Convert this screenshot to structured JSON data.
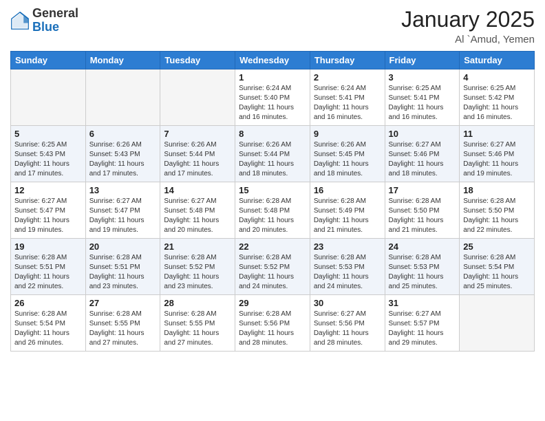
{
  "header": {
    "logo_general": "General",
    "logo_blue": "Blue",
    "month_year": "January 2025",
    "location": "Al `Amud, Yemen"
  },
  "days_of_week": [
    "Sunday",
    "Monday",
    "Tuesday",
    "Wednesday",
    "Thursday",
    "Friday",
    "Saturday"
  ],
  "weeks": [
    [
      {
        "day": "",
        "info": ""
      },
      {
        "day": "",
        "info": ""
      },
      {
        "day": "",
        "info": ""
      },
      {
        "day": "1",
        "info": "Sunrise: 6:24 AM\nSunset: 5:40 PM\nDaylight: 11 hours and 16 minutes."
      },
      {
        "day": "2",
        "info": "Sunrise: 6:24 AM\nSunset: 5:41 PM\nDaylight: 11 hours and 16 minutes."
      },
      {
        "day": "3",
        "info": "Sunrise: 6:25 AM\nSunset: 5:41 PM\nDaylight: 11 hours and 16 minutes."
      },
      {
        "day": "4",
        "info": "Sunrise: 6:25 AM\nSunset: 5:42 PM\nDaylight: 11 hours and 16 minutes."
      }
    ],
    [
      {
        "day": "5",
        "info": "Sunrise: 6:25 AM\nSunset: 5:43 PM\nDaylight: 11 hours and 17 minutes."
      },
      {
        "day": "6",
        "info": "Sunrise: 6:26 AM\nSunset: 5:43 PM\nDaylight: 11 hours and 17 minutes."
      },
      {
        "day": "7",
        "info": "Sunrise: 6:26 AM\nSunset: 5:44 PM\nDaylight: 11 hours and 17 minutes."
      },
      {
        "day": "8",
        "info": "Sunrise: 6:26 AM\nSunset: 5:44 PM\nDaylight: 11 hours and 18 minutes."
      },
      {
        "day": "9",
        "info": "Sunrise: 6:26 AM\nSunset: 5:45 PM\nDaylight: 11 hours and 18 minutes."
      },
      {
        "day": "10",
        "info": "Sunrise: 6:27 AM\nSunset: 5:46 PM\nDaylight: 11 hours and 18 minutes."
      },
      {
        "day": "11",
        "info": "Sunrise: 6:27 AM\nSunset: 5:46 PM\nDaylight: 11 hours and 19 minutes."
      }
    ],
    [
      {
        "day": "12",
        "info": "Sunrise: 6:27 AM\nSunset: 5:47 PM\nDaylight: 11 hours and 19 minutes."
      },
      {
        "day": "13",
        "info": "Sunrise: 6:27 AM\nSunset: 5:47 PM\nDaylight: 11 hours and 19 minutes."
      },
      {
        "day": "14",
        "info": "Sunrise: 6:27 AM\nSunset: 5:48 PM\nDaylight: 11 hours and 20 minutes."
      },
      {
        "day": "15",
        "info": "Sunrise: 6:28 AM\nSunset: 5:48 PM\nDaylight: 11 hours and 20 minutes."
      },
      {
        "day": "16",
        "info": "Sunrise: 6:28 AM\nSunset: 5:49 PM\nDaylight: 11 hours and 21 minutes."
      },
      {
        "day": "17",
        "info": "Sunrise: 6:28 AM\nSunset: 5:50 PM\nDaylight: 11 hours and 21 minutes."
      },
      {
        "day": "18",
        "info": "Sunrise: 6:28 AM\nSunset: 5:50 PM\nDaylight: 11 hours and 22 minutes."
      }
    ],
    [
      {
        "day": "19",
        "info": "Sunrise: 6:28 AM\nSunset: 5:51 PM\nDaylight: 11 hours and 22 minutes."
      },
      {
        "day": "20",
        "info": "Sunrise: 6:28 AM\nSunset: 5:51 PM\nDaylight: 11 hours and 23 minutes."
      },
      {
        "day": "21",
        "info": "Sunrise: 6:28 AM\nSunset: 5:52 PM\nDaylight: 11 hours and 23 minutes."
      },
      {
        "day": "22",
        "info": "Sunrise: 6:28 AM\nSunset: 5:52 PM\nDaylight: 11 hours and 24 minutes."
      },
      {
        "day": "23",
        "info": "Sunrise: 6:28 AM\nSunset: 5:53 PM\nDaylight: 11 hours and 24 minutes."
      },
      {
        "day": "24",
        "info": "Sunrise: 6:28 AM\nSunset: 5:53 PM\nDaylight: 11 hours and 25 minutes."
      },
      {
        "day": "25",
        "info": "Sunrise: 6:28 AM\nSunset: 5:54 PM\nDaylight: 11 hours and 25 minutes."
      }
    ],
    [
      {
        "day": "26",
        "info": "Sunrise: 6:28 AM\nSunset: 5:54 PM\nDaylight: 11 hours and 26 minutes."
      },
      {
        "day": "27",
        "info": "Sunrise: 6:28 AM\nSunset: 5:55 PM\nDaylight: 11 hours and 27 minutes."
      },
      {
        "day": "28",
        "info": "Sunrise: 6:28 AM\nSunset: 5:55 PM\nDaylight: 11 hours and 27 minutes."
      },
      {
        "day": "29",
        "info": "Sunrise: 6:28 AM\nSunset: 5:56 PM\nDaylight: 11 hours and 28 minutes."
      },
      {
        "day": "30",
        "info": "Sunrise: 6:27 AM\nSunset: 5:56 PM\nDaylight: 11 hours and 28 minutes."
      },
      {
        "day": "31",
        "info": "Sunrise: 6:27 AM\nSunset: 5:57 PM\nDaylight: 11 hours and 29 minutes."
      },
      {
        "day": "",
        "info": ""
      }
    ]
  ]
}
